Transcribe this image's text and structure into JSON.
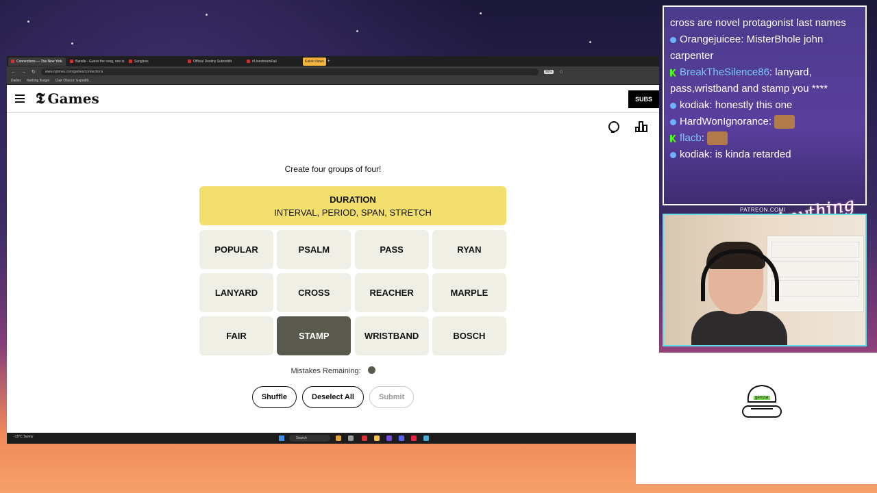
{
  "browser": {
    "tabs": [
      {
        "label": "Connections — The New York",
        "active": true
      },
      {
        "label": "Bandle - Guess the song, one in"
      },
      {
        "label": "Songless"
      },
      {
        "label": "Official Destiny Subreddit"
      },
      {
        "label": "r/LivestreamFail"
      },
      {
        "label": "Kalolo News",
        "news": true
      }
    ],
    "url": "www.nytimes.com/games/connections",
    "zoom": "90%",
    "bookmarks": [
      "Dailies",
      "Nothing Burger",
      "Clair Obscur: Expediti..."
    ]
  },
  "nyt": {
    "logo_text": "Games",
    "subscribe_label": "SUBS",
    "prompt": "Create four groups of four!",
    "solved": {
      "category": "DURATION",
      "words": "INTERVAL, PERIOD, SPAN, STRETCH",
      "color": "#f3df6d"
    },
    "cards": [
      {
        "word": "POPULAR",
        "selected": false
      },
      {
        "word": "PSALM",
        "selected": false
      },
      {
        "word": "PASS",
        "selected": false
      },
      {
        "word": "RYAN",
        "selected": false
      },
      {
        "word": "LANYARD",
        "selected": false
      },
      {
        "word": "CROSS",
        "selected": false
      },
      {
        "word": "REACHER",
        "selected": false
      },
      {
        "word": "MARPLE",
        "selected": false
      },
      {
        "word": "FAIR",
        "selected": false
      },
      {
        "word": "STAMP",
        "selected": true
      },
      {
        "word": "WRISTBAND",
        "selected": false
      },
      {
        "word": "BOSCH",
        "selected": false
      }
    ],
    "mistakes_label": "Mistakes Remaining:",
    "mistakes_remaining": 1,
    "buttons": {
      "shuffle": "Shuffle",
      "deselect": "Deselect All",
      "submit": "Submit"
    }
  },
  "taskbar": {
    "weather": "-15°C Sunny",
    "search": "Search"
  },
  "chat": {
    "partial_top": "cross are novel protagonist last names",
    "messages": [
      {
        "user": "Orangejuicee",
        "text": "MisterBhole john carpenter",
        "badge": "circle",
        "user_color": "#ffffff"
      },
      {
        "user": "BreakTheSilence86",
        "text": "lanyard, pass,wristband and stamp you ****",
        "badge": "kick",
        "user_color": "#7cc6ff"
      },
      {
        "user": "kodiak",
        "text": "honestly this one",
        "badge": "circle",
        "user_color": "#ffffff"
      },
      {
        "user": "HardWonIgnorance",
        "text": "",
        "badge": "circle",
        "user_color": "#ffffff",
        "emote": true
      },
      {
        "user": "flacb",
        "text": "",
        "badge": "kick",
        "user_color": "#7cc6ff",
        "emote": true
      },
      {
        "user": "kodiak",
        "text": "is kinda retarded",
        "badge": "circle",
        "user_color": "#ffffff"
      }
    ]
  },
  "overlay": {
    "patreon": "PATREON.COM/",
    "script": "Anything Else",
    "mascot_label": "gemzar"
  }
}
